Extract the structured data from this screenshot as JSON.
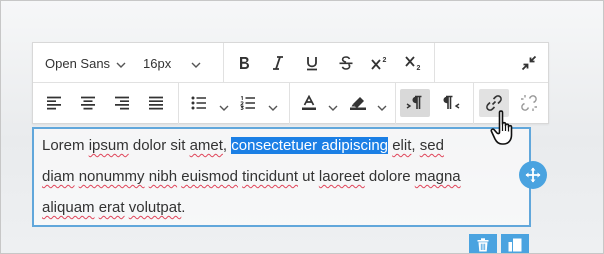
{
  "toolbar": {
    "font_family": "Open Sans",
    "font_size": "16px",
    "buttons": [
      "bold",
      "italic",
      "underline",
      "strikethrough",
      "superscript",
      "subscript",
      "collapse",
      "align-left",
      "align-center",
      "align-right",
      "justify",
      "bulleted-list",
      "numbered-list",
      "text-color",
      "highlight-color",
      "ltr",
      "rtl",
      "link",
      "unlink"
    ]
  },
  "editor": {
    "text_before": "Lorem ipsum dolor sit amet, ",
    "selected_text": "consectetuer adipiscing",
    "line1_after": " elit, sed",
    "line2": "diam nonummy nibh euismod tincidunt ut laoreet dolore magna",
    "line3": "aliquam erat volutpat."
  },
  "colors": {
    "accent": "#4aa3e0",
    "selection": "#1b7fe5",
    "border": "#61a7db",
    "spellcheck": "#e0455a"
  }
}
